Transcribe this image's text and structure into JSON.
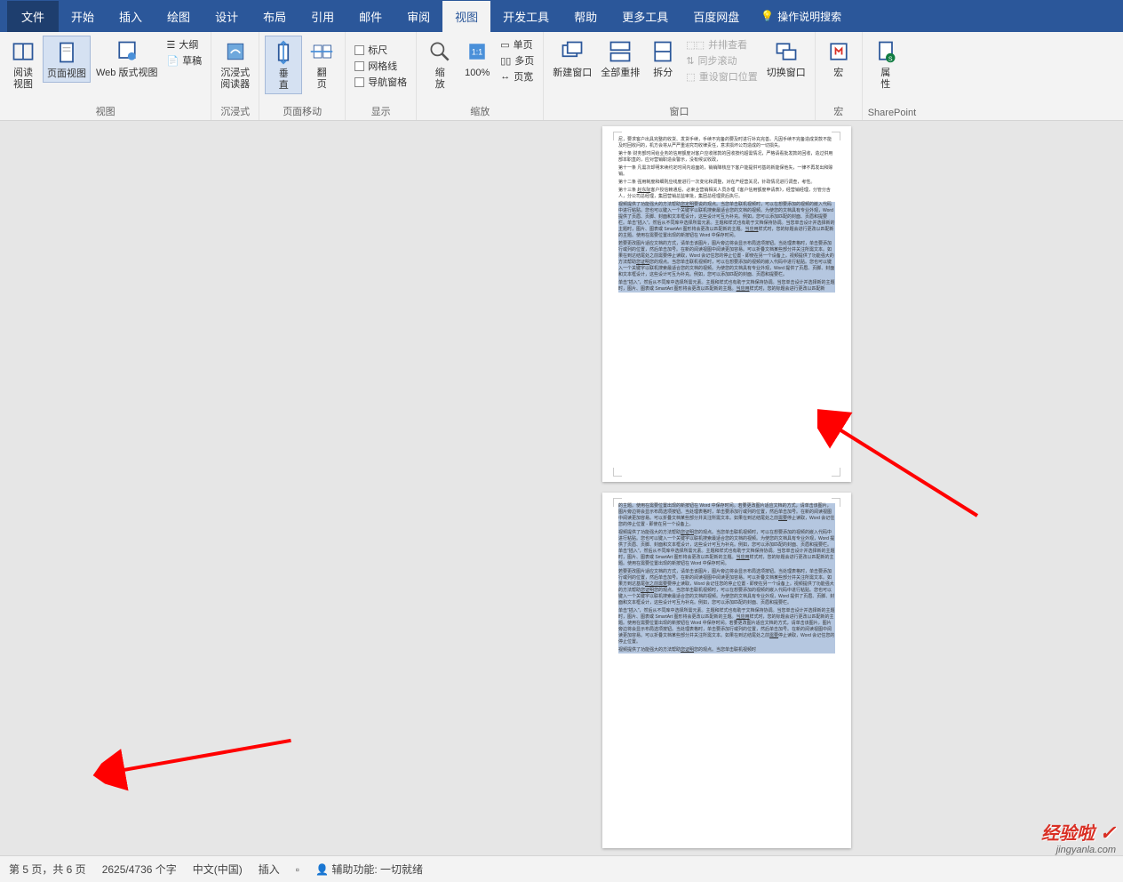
{
  "menubar": {
    "file": "文件",
    "tabs": [
      "开始",
      "插入",
      "绘图",
      "设计",
      "布局",
      "引用",
      "邮件",
      "审阅",
      "视图",
      "开发工具",
      "帮助",
      "更多工具",
      "百度网盘"
    ],
    "active_index": 8,
    "help_hint": "操作说明搜索"
  },
  "ribbon": {
    "views": {
      "read": "阅读\n视图",
      "page": "页面视图",
      "web": "Web 版式视图",
      "outline": "大纲",
      "draft": "草稿",
      "label": "视图"
    },
    "immersive": {
      "reader": "沉浸式\n阅读器",
      "label": "沉浸式"
    },
    "page_move": {
      "vertical": "垂\n直",
      "flip": "翻\n页",
      "label": "页面移动"
    },
    "show": {
      "ruler": "标尺",
      "gridlines": "网格线",
      "nav": "导航窗格",
      "label": "显示"
    },
    "zoom": {
      "zoom": "缩\n放",
      "pct": "100%",
      "single": "单页",
      "multi": "多页",
      "width": "页宽",
      "label": "缩放"
    },
    "window": {
      "new": "新建窗口",
      "arrange": "全部重排",
      "split": "拆分",
      "side": "并排查看",
      "sync": "同步滚动",
      "reset": "重设窗口位置",
      "switch": "切换窗口",
      "label": "窗口"
    },
    "macro": {
      "macro": "宏",
      "label": "宏"
    },
    "sharepoint": {
      "props": "属\n性",
      "label": "SharePoint"
    }
  },
  "statusbar": {
    "page": "第 5 页，共 6 页",
    "words": "2625/4736 个字",
    "lang": "中文(中国)",
    "insert": "插入",
    "accessibility": "辅助功能: 一切就绪"
  },
  "watermark": {
    "brand": "经验啦",
    "url": "jingyanla.com"
  }
}
